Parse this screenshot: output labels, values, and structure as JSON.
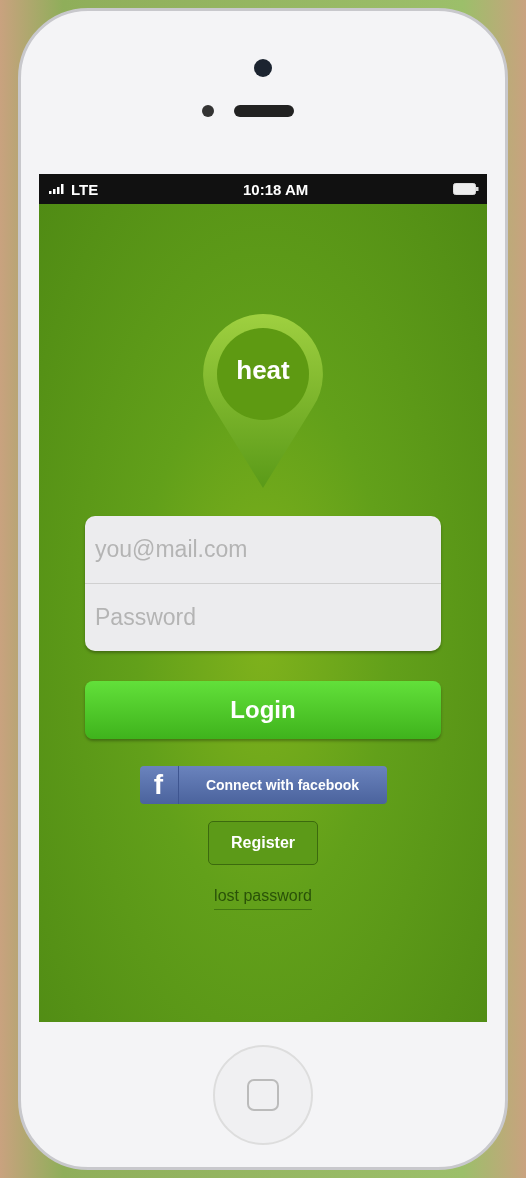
{
  "status_bar": {
    "carrier": "LTE",
    "time": "10:18 AM"
  },
  "logo": {
    "text": "heat"
  },
  "login_form": {
    "email": {
      "placeholder": "you@mail.com"
    },
    "password": {
      "placeholder": "Password"
    }
  },
  "buttons": [
    {
      "kind": "primary",
      "label": "Login"
    },
    {
      "kind": "facebook",
      "label": "Connect with facebook",
      "icon_text": "f"
    },
    {
      "kind": "secondary",
      "label": "Register"
    }
  ],
  "link": "lost password"
}
